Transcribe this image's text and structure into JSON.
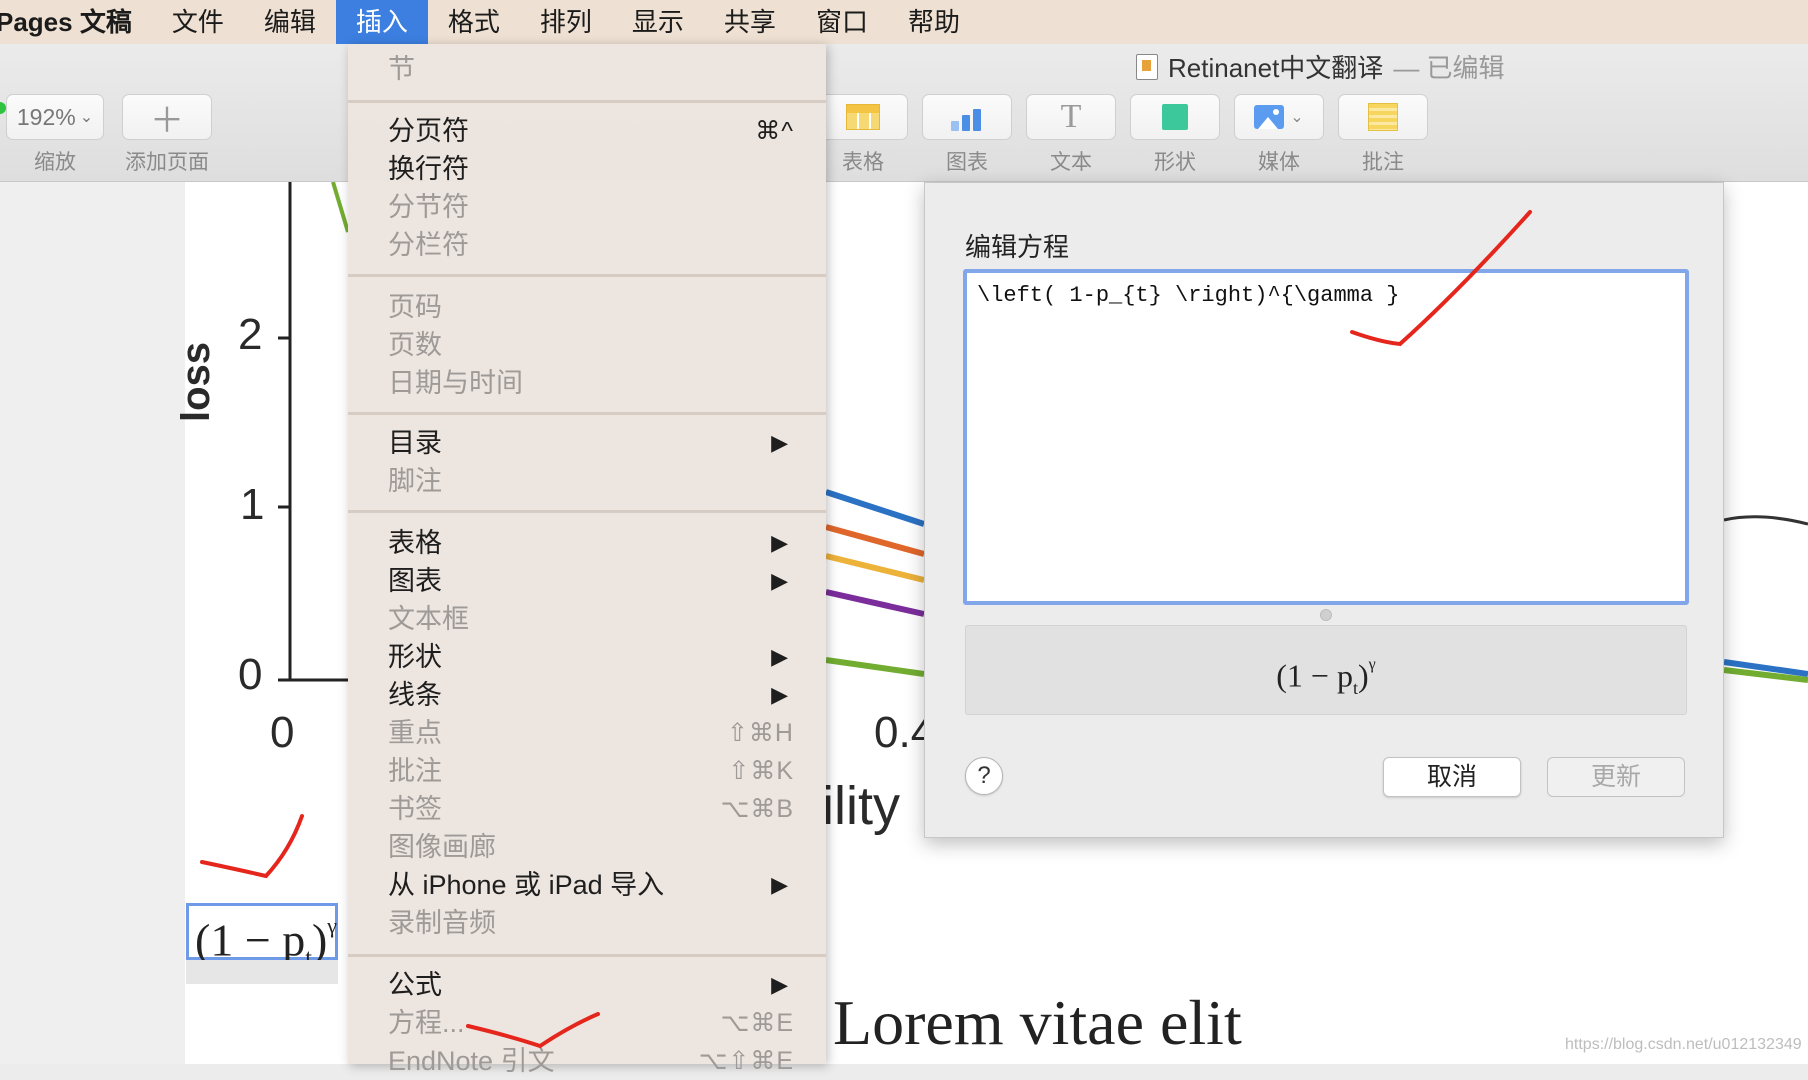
{
  "menubar": {
    "app": "Pages 文稿",
    "items": [
      "文件",
      "编辑",
      "插入",
      "格式",
      "排列",
      "显示",
      "共享",
      "窗口",
      "帮助"
    ]
  },
  "window": {
    "title": "Retinanet中文翻译",
    "edited": "— 已编辑"
  },
  "toolbar": {
    "zoom_value": "192%",
    "zoom_label": "缩放",
    "add_page_label": "添加页面",
    "table_label": "表格",
    "chart_label": "图表",
    "text_label": "文本",
    "shape_label": "形状",
    "media_label": "媒体",
    "comment_label": "批注"
  },
  "insert_menu": {
    "section": "节",
    "page_break": "分页符",
    "page_break_shortcut": "⌘^",
    "line_break": "换行符",
    "section_break": "分节符",
    "column_break": "分栏符",
    "page_number": "页码",
    "page_count": "页数",
    "date_time": "日期与时间",
    "toc": "目录",
    "footnote": "脚注",
    "table": "表格",
    "chart": "图表",
    "text_box": "文本框",
    "shape": "形状",
    "line": "线条",
    "highlight": "重点",
    "highlight_shortcut": "⇧⌘H",
    "comment": "批注",
    "comment_shortcut": "⇧⌘K",
    "bookmark": "书签",
    "bookmark_shortcut": "⌥⌘B",
    "image_gallery": "图像画廊",
    "import_iphone": "从 iPhone 或 iPad 导入",
    "record_audio": "录制音频",
    "formula": "公式",
    "equation": "方程...",
    "equation_shortcut": "⌥⌘E",
    "endnote": "EndNote 引文",
    "endnote_shortcut": "⌥⇧⌘E",
    "submenu_arrow": "▶"
  },
  "document": {
    "y_axis_label": "loss",
    "y_ticks": [
      "2",
      "1",
      "0"
    ],
    "x_ticks": [
      "0",
      "0.4"
    ],
    "x_axis_fragment": "ility",
    "heading": "Lorem vitae elit",
    "equation_base": "(1 − p",
    "equation_sub": "t",
    "equation_close": ")",
    "equation_sup": "γ",
    "watermark": "https://blog.csdn.net/u012132349"
  },
  "equation_dialog": {
    "title": "编辑方程",
    "latex": "\\left( 1-p_{t} \\right)^{\\gamma }",
    "preview_base": "(1 − p",
    "preview_sub": "t",
    "preview_close": ")",
    "preview_sup": "γ",
    "help": "?",
    "cancel": "取消",
    "update": "更新"
  },
  "colors": {
    "menu_highlight": "#3c7fe0",
    "annotation_red": "#e5261c",
    "input_focus": "#82a6ea"
  }
}
